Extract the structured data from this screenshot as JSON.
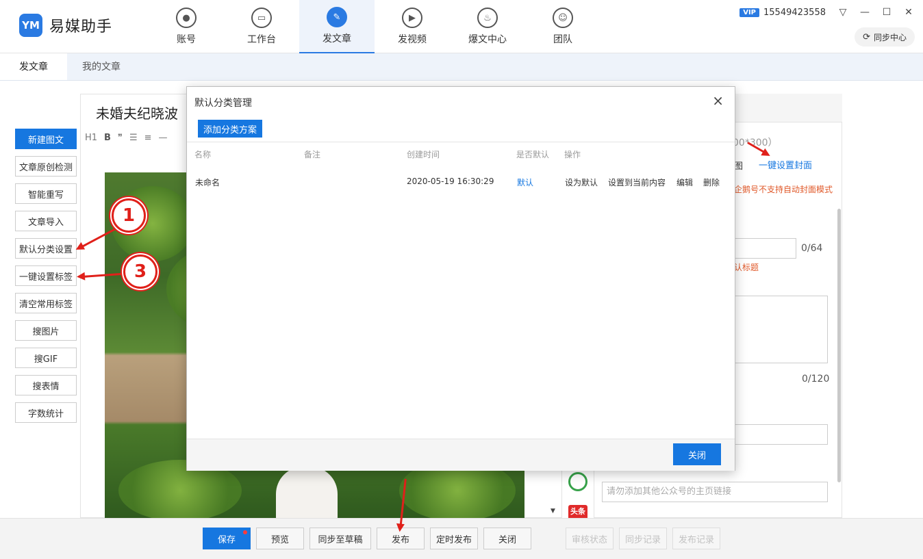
{
  "app": {
    "logo_mark": "YM",
    "name": "易媒助手"
  },
  "nav": [
    {
      "label": "账号",
      "icon": "user-icon",
      "glyph": "●"
    },
    {
      "label": "工作台",
      "icon": "monitor-icon",
      "glyph": "▭"
    },
    {
      "label": "发文章",
      "icon": "feather-icon",
      "glyph": "✎"
    },
    {
      "label": "发视频",
      "icon": "play-icon",
      "glyph": "▶"
    },
    {
      "label": "爆文中心",
      "icon": "flame-icon",
      "glyph": "♨"
    },
    {
      "label": "团队",
      "icon": "team-icon",
      "glyph": "☺"
    }
  ],
  "account": {
    "vip": "VIP",
    "phone": "15549423558"
  },
  "window": {
    "menu": "▽",
    "minimize": "—",
    "maximize": "☐",
    "close": "✕"
  },
  "sync_center": {
    "icon": "⟳",
    "label": "同步中心"
  },
  "subtabs": [
    "发文章",
    "我的文章"
  ],
  "tools": [
    "新建图文",
    "文章原创检测",
    "智能重写",
    "文章导入",
    "默认分类设置",
    "一键设置标签",
    "清空常用标签",
    "搜图片",
    "搜GIF",
    "搜表情",
    "字数统计"
  ],
  "editor": {
    "title": "未婚夫纪晓波",
    "toolbar": [
      "H1",
      "B",
      "❞",
      "☰",
      "≡",
      "—"
    ]
  },
  "right_panel": {
    "cover_size": "00*300）",
    "cover_tu": "图",
    "cover_link": "一键设置封面",
    "cover_warning": "企鹅号不支持自动封面模式",
    "title_count": "0/64",
    "title_error": "认标题",
    "summary_count": "0/120",
    "homepage_placeholder": "请勿添加其他公众号的主页链接",
    "toutiao_badge": "头条"
  },
  "bottom": {
    "save": "保存",
    "preview": "预览",
    "sync_draft": "同步至草稿",
    "publish": "发布",
    "schedule": "定时发布",
    "close": "关闭",
    "audit_status": "审核状态",
    "sync_record": "同步记录",
    "publish_record": "发布记录"
  },
  "annotations": [
    "1",
    "3"
  ],
  "modal": {
    "title": "默认分类管理",
    "close_icon": "×",
    "add_button": "添加分类方案",
    "columns": {
      "name": "名称",
      "note": "备注",
      "created": "创建时间",
      "is_default": "是否默认",
      "actions": "操作"
    },
    "rows": [
      {
        "name": "未命名",
        "note": "",
        "created": "2020-05-19 16:30:29",
        "is_default": "默认",
        "action_set_default": "设为默认",
        "action_apply": "设置到当前内容",
        "action_edit": "编辑",
        "action_delete": "删除"
      }
    ],
    "footer_close": "关闭"
  }
}
